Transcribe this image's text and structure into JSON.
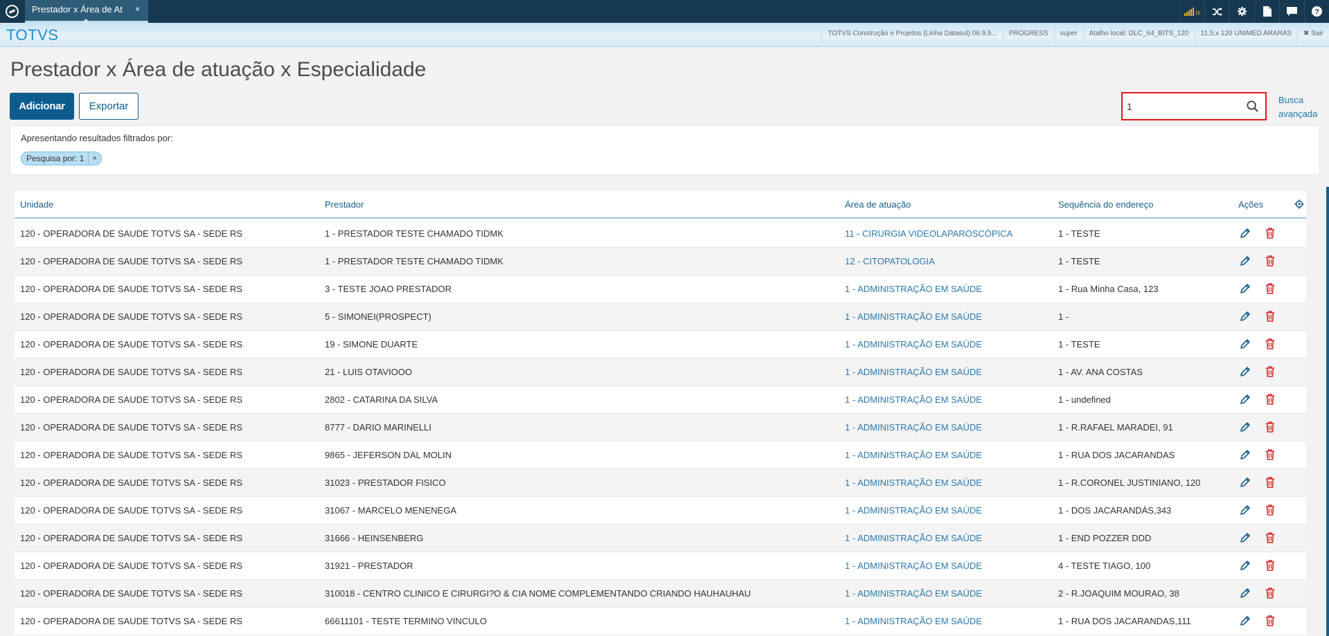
{
  "topbar": {
    "tab_title": "Prestador x Área de At",
    "tab_close": "×",
    "icons": [
      "signal-icon",
      "shuffle-icon",
      "gear-icon",
      "document-icon",
      "chat-icon",
      "help-icon"
    ],
    "signal_label": "DI"
  },
  "subbar": {
    "brand": "TOTVS",
    "info": [
      "TOTVS Construção e Projetos (Linha Datasul) 06.9.5...",
      "PROGRESS",
      "super",
      "Atalho local: DLC_64_BITS_120",
      "11.5.x 120 UNIMED ARARAS"
    ],
    "logout": "✖ Sair"
  },
  "page": {
    "title": "Prestador x Área de atuação x Especialidade",
    "add_button": "Adicionar",
    "export_button": "Exportar",
    "search_value": "1",
    "advanced_search": "Busca avançada"
  },
  "filter": {
    "label": "Apresentando resultados filtrados por:",
    "chip": "Pesquisa por: 1",
    "chip_close": "×"
  },
  "table": {
    "columns": [
      "Unidade",
      "Prestador",
      "Área de atuação",
      "Sequência do endereço",
      "Ações"
    ],
    "rows": [
      {
        "unidade": "120 - OPERADORA DE SAUDE TOTVS SA - SEDE RS",
        "prestador": "1 - PRESTADOR TESTE CHAMADO TIDMK",
        "area": "11 - CIRURGIA VIDEOLAPAROSCÓPICA",
        "seq": "1 - TESTE"
      },
      {
        "unidade": "120 - OPERADORA DE SAUDE TOTVS SA - SEDE RS",
        "prestador": "1 - PRESTADOR TESTE CHAMADO TIDMK",
        "area": "12 - CITOPATOLOGIA",
        "seq": "1 - TESTE"
      },
      {
        "unidade": "120 - OPERADORA DE SAUDE TOTVS SA - SEDE RS",
        "prestador": "3 - TESTE JOAO PRESTADOR",
        "area": "1 - ADMINISTRAÇÃO EM SAÚDE",
        "seq": "1 - Rua Minha Casa, 123"
      },
      {
        "unidade": "120 - OPERADORA DE SAUDE TOTVS SA - SEDE RS",
        "prestador": "5 - SIMONEI(PROSPECT)",
        "area": "1 - ADMINISTRAÇÃO EM SAÚDE",
        "seq": "1 -"
      },
      {
        "unidade": "120 - OPERADORA DE SAUDE TOTVS SA - SEDE RS",
        "prestador": "19 - SIMONE DUARTE",
        "area": "1 - ADMINISTRAÇÃO EM SAÚDE",
        "seq": "1 - TESTE"
      },
      {
        "unidade": "120 - OPERADORA DE SAUDE TOTVS SA - SEDE RS",
        "prestador": "21 - LUIS OTAVIOOO",
        "area": "1 - ADMINISTRAÇÃO EM SAÚDE",
        "seq": "1 - AV. ANA COSTAS"
      },
      {
        "unidade": "120 - OPERADORA DE SAUDE TOTVS SA - SEDE RS",
        "prestador": "2802 - CATARINA DA SILVA",
        "area": "1 - ADMINISTRAÇÃO EM SAÚDE",
        "seq": "1 - undefined"
      },
      {
        "unidade": "120 - OPERADORA DE SAUDE TOTVS SA - SEDE RS",
        "prestador": "8777 - DARIO MARINELLI",
        "area": "1 - ADMINISTRAÇÃO EM SAÚDE",
        "seq": "1 - R.RAFAEL MARADEI, 91"
      },
      {
        "unidade": "120 - OPERADORA DE SAUDE TOTVS SA - SEDE RS",
        "prestador": "9865 - JEFERSON DAL MOLIN",
        "area": "1 - ADMINISTRAÇÃO EM SAÚDE",
        "seq": "1 - RUA DOS JACARANDAS"
      },
      {
        "unidade": "120 - OPERADORA DE SAUDE TOTVS SA - SEDE RS",
        "prestador": "31023 - PRESTADOR FISICO",
        "area": "1 - ADMINISTRAÇÃO EM SAÚDE",
        "seq": "1 - R.CORONEL JUSTINIANO, 120"
      },
      {
        "unidade": "120 - OPERADORA DE SAUDE TOTVS SA - SEDE RS",
        "prestador": "31067 - MARCELO MENENEGA",
        "area": "1 - ADMINISTRAÇÃO EM SAÚDE",
        "seq": "1 - DOS JACARANDÁS,343"
      },
      {
        "unidade": "120 - OPERADORA DE SAUDE TOTVS SA - SEDE RS",
        "prestador": "31666 - HEINSENBERG",
        "area": "1 - ADMINISTRAÇÃO EM SAÚDE",
        "seq": "1 - END POZZER DDD"
      },
      {
        "unidade": "120 - OPERADORA DE SAUDE TOTVS SA - SEDE RS",
        "prestador": "31921 - PRESTADOR",
        "area": "1 - ADMINISTRAÇÃO EM SAÚDE",
        "seq": "4 - TESTE TIAGO, 100"
      },
      {
        "unidade": "120 - OPERADORA DE SAUDE TOTVS SA - SEDE RS",
        "prestador": "310018 - CENTRO CLINICO E CIRURGI?O & CIA NOME COMPLEMENTANDO CRIANDO HAUHAUHAU",
        "area": "1 - ADMINISTRAÇÃO EM SAÚDE",
        "seq": "2 - R.JOAQUIM MOURAO, 38"
      },
      {
        "unidade": "120 - OPERADORA DE SAUDE TOTVS SA - SEDE RS",
        "prestador": "66611101 - TESTE TERMINO VINCULO",
        "area": "1 - ADMINISTRAÇÃO EM SAÚDE",
        "seq": "1 - RUA DOS JACARANDAS,111"
      }
    ]
  },
  "colors": {
    "topbar": "#17394f",
    "primary": "#0c5c8e",
    "link": "#2c77ab",
    "delete": "#d9262a",
    "highlight": "#e3141c"
  }
}
